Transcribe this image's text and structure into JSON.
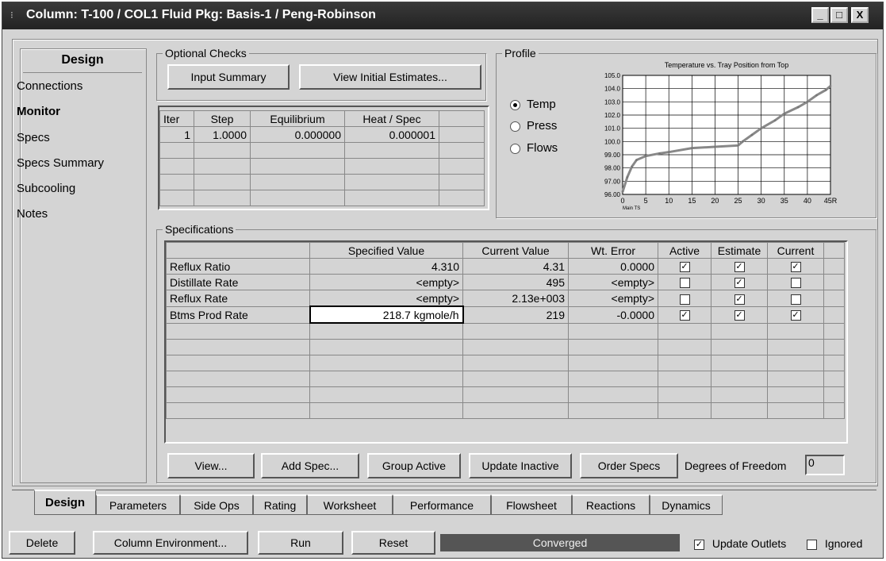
{
  "window": {
    "title": "Column: T-100 / COL1  Fluid Pkg: Basis-1 / Peng-Robinson",
    "min": "_",
    "max": "□",
    "close": "X"
  },
  "sidebar": {
    "title": "Design",
    "items": [
      {
        "label": "Connections"
      },
      {
        "label": "Monitor"
      },
      {
        "label": "Specs"
      },
      {
        "label": "Specs Summary"
      },
      {
        "label": "Subcooling"
      },
      {
        "label": "Notes"
      }
    ]
  },
  "optional_checks": {
    "title": "Optional Checks",
    "input_summary": "Input Summary",
    "view_estimates": "View Initial Estimates..."
  },
  "iter_table": {
    "headers": [
      "Iter",
      "Step",
      "Equilibrium",
      "Heat / Spec"
    ],
    "rows": [
      [
        "1",
        "1.0000",
        "0.000000",
        "0.000001"
      ]
    ]
  },
  "profile": {
    "title": "Profile",
    "options": [
      "Temp",
      "Press",
      "Flows"
    ],
    "selected": "Temp"
  },
  "chart_data": {
    "type": "line",
    "title": "Temperature vs. Tray Position from Top",
    "x": [
      0,
      1,
      2,
      3,
      5,
      8,
      10,
      15,
      20,
      25,
      26,
      28,
      30,
      33,
      35,
      38,
      40,
      42,
      44,
      45
    ],
    "y": [
      96.2,
      97.3,
      98.1,
      98.6,
      98.9,
      99.1,
      99.2,
      99.5,
      99.6,
      99.7,
      100.0,
      100.5,
      101.0,
      101.6,
      102.1,
      102.6,
      103.0,
      103.5,
      103.9,
      104.2
    ],
    "xticks": [
      "0",
      "5",
      "10",
      "15",
      "20",
      "25",
      "30",
      "35",
      "40",
      "45R"
    ],
    "yticks": [
      "96.00",
      "97.00",
      "98.00",
      "99.00",
      "100.0",
      "101.0",
      "102.0",
      "103.0",
      "104.0",
      "105.0"
    ],
    "xlabel_small": "Main TS",
    "xlim": [
      0,
      45
    ],
    "ylim": [
      96,
      105
    ],
    "grid": true
  },
  "specs": {
    "title": "Specifications",
    "headers": [
      "",
      "Specified Value",
      "Current Value",
      "Wt. Error",
      "Active",
      "Estimate",
      "Current"
    ],
    "rows": [
      {
        "name": "Reflux Ratio",
        "spec": "4.310",
        "cur": "4.31",
        "err": "0.0000",
        "active": true,
        "estimate": true,
        "current": true
      },
      {
        "name": "Distillate Rate",
        "spec": "<empty>",
        "cur": "495",
        "err": "<empty>",
        "active": false,
        "estimate": true,
        "current": false
      },
      {
        "name": "Reflux Rate",
        "spec": "<empty>",
        "cur": "2.13e+003",
        "err": "<empty>",
        "active": false,
        "estimate": true,
        "current": false
      },
      {
        "name": "Btms Prod Rate",
        "spec": "218.7 kgmole/h",
        "cur": "219",
        "err": "-0.0000",
        "active": true,
        "estimate": true,
        "current": true
      }
    ]
  },
  "spec_buttons": {
    "view": "View...",
    "add": "Add Spec...",
    "group": "Group Active",
    "update": "Update Inactive",
    "order": "Order Specs",
    "dof_label": "Degrees of Freedom",
    "dof_value": "0"
  },
  "tabs": [
    "Design",
    "Parameters",
    "Side Ops",
    "Rating",
    "Worksheet",
    "Performance",
    "Flowsheet",
    "Reactions",
    "Dynamics"
  ],
  "bottom": {
    "delete": "Delete",
    "env": "Column Environment...",
    "run": "Run",
    "reset": "Reset",
    "status": "Converged",
    "update_outlets": "Update Outlets",
    "ignored": "Ignored"
  }
}
